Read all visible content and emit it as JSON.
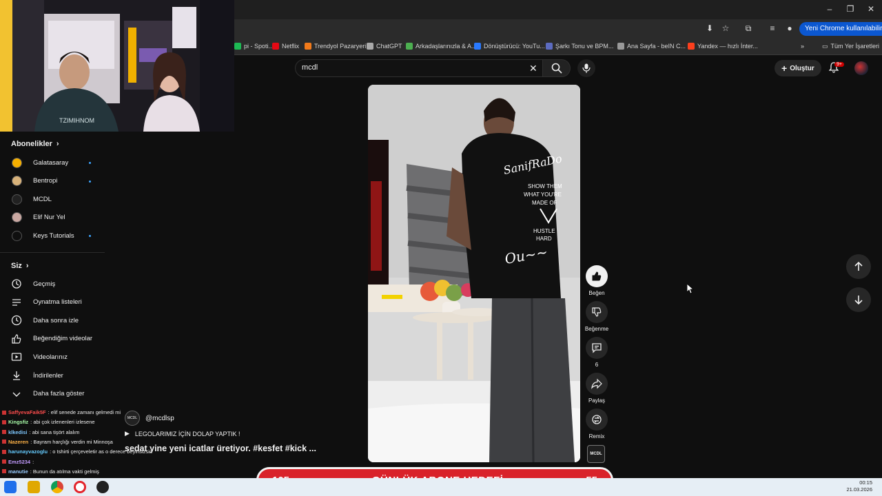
{
  "window": {
    "minimize": "–",
    "restore": "❐",
    "close": "✕"
  },
  "browser": {
    "chrome_pill": "Yeni Chrome kullanılabilir"
  },
  "bookmarks": {
    "items": [
      {
        "label": "pi - Spoti...",
        "color": "#1db954"
      },
      {
        "label": "Netflix",
        "color": "#e50914"
      },
      {
        "label": "Trendyol Pazaryeri",
        "color": "#f27a1a"
      },
      {
        "label": "ChatGPT",
        "color": "#aaaaaa"
      },
      {
        "label": "Arkadaşlarınızla & A...",
        "color": "#4caf50"
      },
      {
        "label": "Dönüştürücü: YouTu...",
        "color": "#2979ff"
      },
      {
        "label": "Şarkı Tonu ve BPM...",
        "color": "#5c6bc0"
      },
      {
        "label": "Ana Sayfa - beIN C...",
        "color": "#999999"
      },
      {
        "label": "Yandex — hızlı İnter...",
        "color": "#fc3f1d"
      }
    ],
    "all_label": "Tüm Yer İşaretleri"
  },
  "youtube": {
    "search_query": "mcdl",
    "create_label": "Oluştur",
    "notif_badge": "9+"
  },
  "sidebar": {
    "subs_title": "Abonelikler",
    "subscriptions": [
      {
        "label": "Galatasaray",
        "color": "#f6b000",
        "dot": true
      },
      {
        "label": "Bentropi",
        "color": "#d8b27a",
        "dot": true
      },
      {
        "label": "MCDL",
        "color": "#222222",
        "dot": false
      },
      {
        "label": "Elif Nur Yel",
        "color": "#c9a7a1",
        "dot": false
      },
      {
        "label": "Keys Tutorials",
        "color": "#0f0f0f",
        "dot": true
      }
    ],
    "you_title": "Siz",
    "you_items": [
      {
        "label": "Geçmiş",
        "icon": "history-icon"
      },
      {
        "label": "Oynatma listeleri",
        "icon": "playlist-icon"
      },
      {
        "label": "Daha sonra izle",
        "icon": "clock-icon"
      },
      {
        "label": "Beğendiğim videolar",
        "icon": "thumb-up-icon"
      },
      {
        "label": "Videolarınız",
        "icon": "video-icon"
      },
      {
        "label": "İndirilenler",
        "icon": "download-icon"
      },
      {
        "label": "Daha fazla göster",
        "icon": "chevron-down-icon"
      }
    ]
  },
  "short": {
    "actions": [
      {
        "label": "Beğen",
        "icon": "thumb-up-icon"
      },
      {
        "label": "Beğenme",
        "icon": "thumb-down-icon"
      },
      {
        "label": "6",
        "icon": "comment-icon"
      },
      {
        "label": "Paylaş",
        "icon": "share-icon"
      },
      {
        "label": "Remix",
        "icon": "remix-icon"
      }
    ],
    "channel": "@mcdlsp",
    "title": "LEGOLARIMIZ İÇİN DOLAP YAPTIK !",
    "description": "sedat yine yeni icatlar üretiyor. #kesfet #kick ...",
    "channel_avatar_text": "MCDL"
  },
  "chat": [
    {
      "user": "SaffyevaFaik5F",
      "msg": ": elif senede zamanı gelmedi mi",
      "color": "#ff4d4d"
    },
    {
      "user": "Kingsfiz",
      "msg": ": abi çok izlenenleri izlesene",
      "color": "#aaffaa"
    },
    {
      "user": "klkedisi",
      "msg": ": abi sana tişört alalım",
      "color": "#7ec8ff"
    },
    {
      "user": "Nazeren",
      "msg": ": Bayram harçlığı verdin mi Minnoşa",
      "color": "#ffb347"
    },
    {
      "user": "harunayvazoglu",
      "msg": ": o tshirti çerçeveletir as o derece beyinsizsin",
      "color": "#66ccff"
    },
    {
      "user": "Emz5234",
      "msg": ":",
      "color": "#c39bff"
    },
    {
      "user": "manutie",
      "msg": ": Bunun da atılma vakti gelmiş",
      "color": "#9cf"
    }
  ],
  "goal": {
    "left": "105",
    "title": "GÜNLÜK ABONE HEDEFİ",
    "right": "55"
  },
  "clock": {
    "time": "00:15",
    "date": "21.03.2026"
  }
}
